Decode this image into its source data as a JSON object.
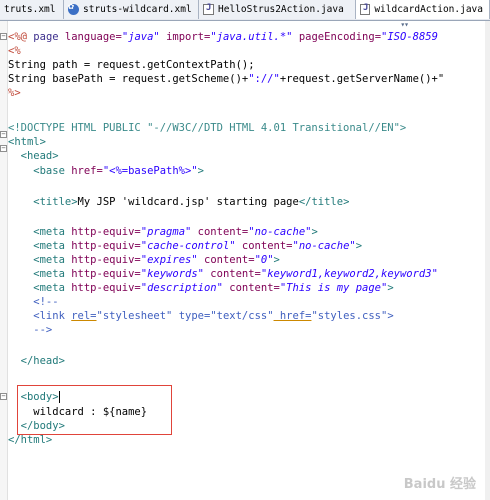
{
  "tabs": [
    {
      "label": "truts.xml",
      "icon": "none"
    },
    {
      "label": "struts-wildcard.xml",
      "icon": "xml-config-icon"
    },
    {
      "label": "HelloStrus2Action.java",
      "icon": "java-file-icon"
    },
    {
      "label": "wildcardAction.java",
      "icon": "java-file-icon"
    }
  ],
  "tab_overflow": "▾▾",
  "code": {
    "l1_open": "<%@ ",
    "l1_page": "page",
    "l1_lang_attr": " language=",
    "l1_lang_val": "\"java\"",
    "l1_import_attr": " import=",
    "l1_import_val": "\"java.util.*\"",
    "l1_enc_attr": " pageEncoding=",
    "l1_enc_val": "\"ISO-8859",
    "l2": "<%",
    "l3": "String path = request.getContextPath();",
    "l4a": "String basePath = request.getScheme()+",
    "l4b": "\"://\"",
    "l4c": "+request.getServerName()+\"",
    "l5": "%>",
    "l7": "<!DOCTYPE HTML PUBLIC \"-//W3C//DTD HTML 4.01 Transitional//EN\">",
    "l8": "<html>",
    "l9": "  <head>",
    "l10a": "    <base ",
    "l10b": "href=",
    "l10c": "\"<%=basePath%>\"",
    "l10d": ">",
    "l12a": "    <title>",
    "l12b": "My JSP 'wildcard.jsp' starting page",
    "l12c": "</title>",
    "meta_open": "    <meta ",
    "meta_attr": "http-equiv=",
    "meta_content": " content=",
    "meta_close": ">",
    "m1_eq": "\"pragma\"",
    "m1_val": "\"no-cache\"",
    "m2_eq": "\"cache-control\"",
    "m2_val": "\"no-cache\"",
    "m3_eq": "\"expires\"",
    "m3_val": "\"0\"",
    "m4_eq": "\"keywords\"",
    "m4_val": "\"keyword1,keyword2,keyword3\"",
    "m5_eq": "\"description\"",
    "m5_val": "\"This is my page\"",
    "c_open": "    <!--",
    "link_a": "    <link ",
    "link_rel": "rel=",
    "link_relv": "\"stylesheet\"",
    "link_type": " type=",
    "link_typev": "\"text/css\"",
    "link_href": " href=",
    "link_hrefv": "\"styles.css\"",
    "link_end": ">",
    "c_close": "    -->",
    "head_close": "  </head>",
    "body_open": "  <body>",
    "body_text": "    wildcard : ${name}",
    "body_close": "  </body>",
    "html_close": "</html>"
  },
  "watermark": "Baidu 经验"
}
